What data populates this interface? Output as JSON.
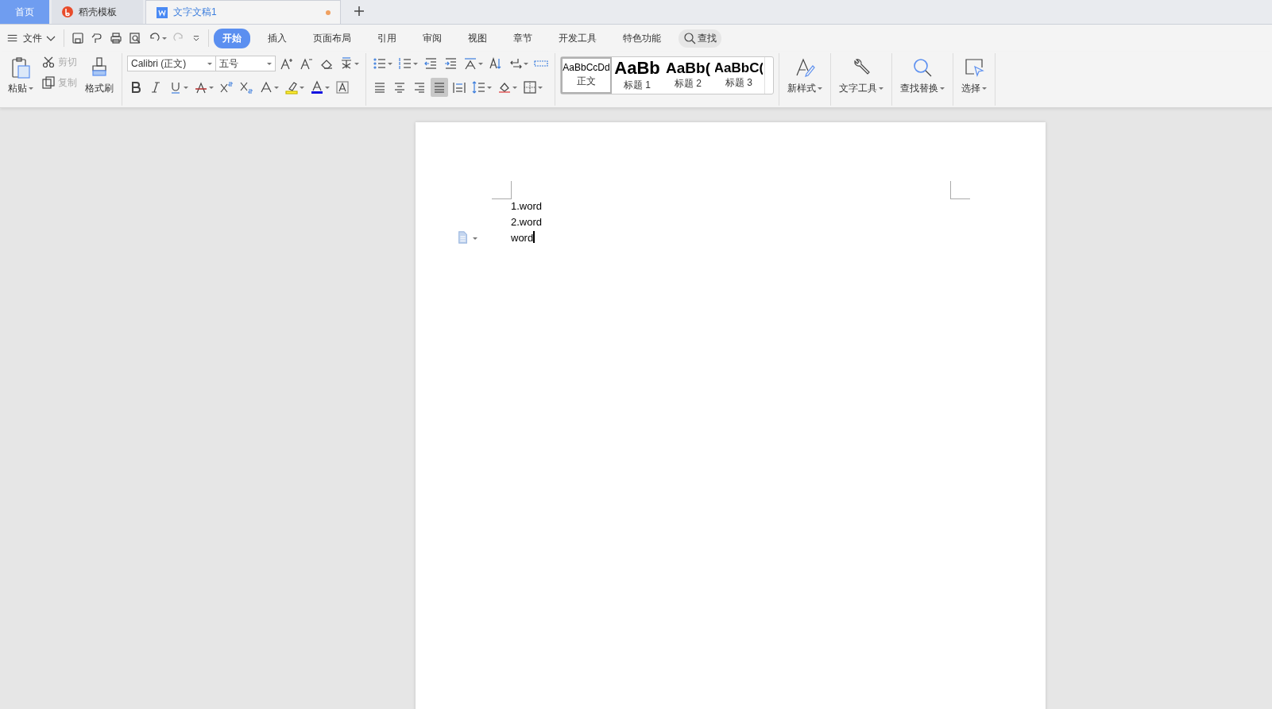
{
  "tabs": [
    {
      "kind": "home",
      "label": "首页",
      "selected": false,
      "modified": false
    },
    {
      "kind": "docer",
      "label": "稻壳模板",
      "selected": false,
      "modified": false
    },
    {
      "kind": "doc",
      "label": "文字文稿1",
      "selected": true,
      "modified": true
    }
  ],
  "menu": {
    "file": "文件",
    "tabs": [
      {
        "label": "开始",
        "selected": true
      },
      {
        "label": "插入",
        "selected": false
      },
      {
        "label": "页面布局",
        "selected": false
      },
      {
        "label": "引用",
        "selected": false
      },
      {
        "label": "审阅",
        "selected": false
      },
      {
        "label": "视图",
        "selected": false
      },
      {
        "label": "章节",
        "selected": false
      },
      {
        "label": "开发工具",
        "selected": false
      },
      {
        "label": "特色功能",
        "selected": false
      }
    ],
    "search": "查找"
  },
  "clipboard": {
    "paste": "粘贴",
    "cut": {
      "label": "剪切",
      "disabled": true
    },
    "copy": {
      "label": "复制",
      "disabled": true
    },
    "painter": "格式刷"
  },
  "font": {
    "name": "Calibri (正文)",
    "size": "五号"
  },
  "paragraph": {
    "align": [
      {
        "kind": "left",
        "selected": false
      },
      {
        "kind": "center",
        "selected": false
      },
      {
        "kind": "right",
        "selected": false
      },
      {
        "kind": "justify",
        "selected": true
      },
      {
        "kind": "distributed",
        "selected": false
      }
    ]
  },
  "styles": [
    {
      "kind": "body",
      "preview": "AaBbCcDd",
      "label": "正文",
      "selected": true
    },
    {
      "kind": "h1",
      "preview": "AaBb",
      "label": "标题 1",
      "selected": false
    },
    {
      "kind": "h2",
      "preview": "AaBb(",
      "label": "标题 2",
      "selected": false
    },
    {
      "kind": "h3",
      "preview": "AaBbC(",
      "label": "标题 3",
      "selected": false
    }
  ],
  "tools": [
    {
      "kind": "new-style",
      "label": "新样式"
    },
    {
      "kind": "text-tools",
      "label": "文字工具"
    },
    {
      "kind": "find-replace",
      "label": "查找替换"
    },
    {
      "kind": "select",
      "label": "选择"
    }
  ],
  "document": {
    "lines": [
      "1.word",
      "2.word",
      "word"
    ]
  }
}
